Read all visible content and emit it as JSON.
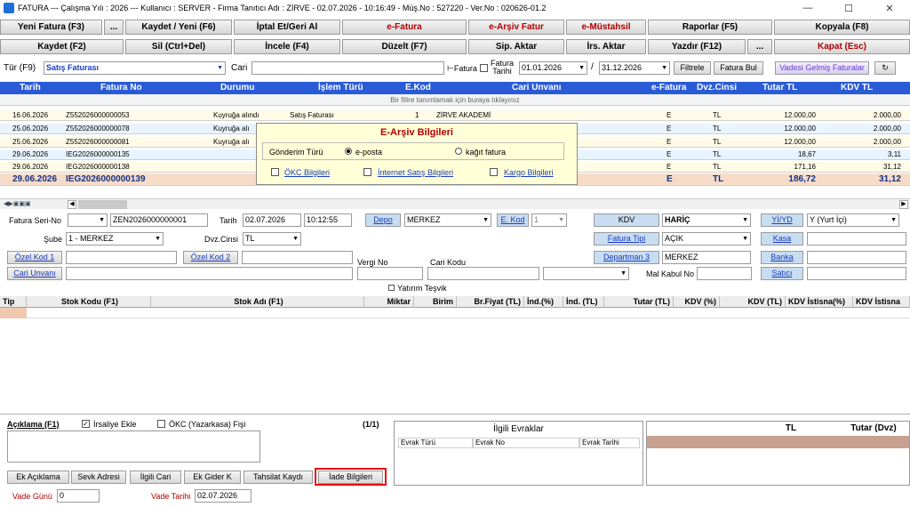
{
  "titlebar": {
    "text": "FATURA  ---  Çalışma Yılı : 2026  ---  Kullanıcı : SERVER - Firma Tanıtıcı Adı : ZİRVE - 02.07.2026 - 10:16:49 - Müş.No : 527220 - Ver.No : 020626-01.2",
    "minimize": "—",
    "maximize": "☐",
    "close": "✕"
  },
  "toolbar1": {
    "new_invoice": "Yeni Fatura (F3)",
    "dots1": "...",
    "save_new": "Kaydet / Yeni (F6)",
    "cancel_restore": "İptal Et/Geri Al",
    "e_invoice": "e-Fatura",
    "e_archive": "e-Arşiv Fatur",
    "e_producer": "e-Müstahsil",
    "reports": "Raporlar (F5)",
    "copy": "Kopyala (F8)"
  },
  "toolbar2": {
    "save": "Kaydet (F2)",
    "delete": "Sil (Ctrl+Del)",
    "review": "İncele (F4)",
    "edit": "Düzelt (F7)",
    "order_transfer": "Sip. Aktar",
    "waybill_transfer": "İrs. Aktar",
    "print": "Yazdır (F12)",
    "dots2": "...",
    "close": "Kapat (Esc)"
  },
  "filter": {
    "type_label": "Tür (F9)",
    "type_value": "Satış Faturası",
    "cari_label": "Cari",
    "e_invoice_label": "⊢Fatura",
    "invoice_date_label1": "Fatura",
    "invoice_date_label2": "Tarihi",
    "date_from": "01.01.2026",
    "date_sep": "/",
    "date_to": "31.12.2026",
    "filter_btn": "Filtrele",
    "invoice_find": "Fatura Bul",
    "due_invoices": "Vadesi Gelmiş Faturalar",
    "refresh": "↻"
  },
  "grid": {
    "columns": [
      "Tarih",
      "Fatura No",
      "Durumu",
      "İşlem Türü",
      "E.Kod",
      "Cari Unvanı",
      "e-Fatura",
      "Dvz.Cinsi",
      "Tutar TL",
      "KDV TL"
    ],
    "filter_hint": "Bir filtre tanımlamak için buraya tıklayınız",
    "rows": [
      {
        "date": "16.06.2026",
        "no": "Z552026000000053",
        "status": "Kuyruğa alındı",
        "type": "Satış Faturası",
        "ekod": "1",
        "cari": "ZİRVE AKADEMİ",
        "ef": "E",
        "cur": "TL",
        "total": "12.000,00",
        "kdv": "2.000,00"
      },
      {
        "date": "25.06.2026",
        "no": "Z552026000000078",
        "status": "Kuyruğa alı",
        "type": "",
        "ekod": "",
        "cari": "",
        "ef": "E",
        "cur": "TL",
        "total": "12.000,00",
        "kdv": "2.000,00"
      },
      {
        "date": "25.06.2026",
        "no": "Z552026000000081",
        "status": "Kuyruğa alı",
        "type": "",
        "ekod": "",
        "cari": "",
        "ef": "E",
        "cur": "TL",
        "total": "12.000,00",
        "kdv": "2.000,00"
      },
      {
        "date": "29.06.2026",
        "no": "IEG2026000000135",
        "status": "",
        "type": "",
        "ekod": "",
        "cari": "",
        "ef": "E",
        "cur": "TL",
        "total": "18,67",
        "kdv": "3,11"
      },
      {
        "date": "29.06.2026",
        "no": "IEG2026000000138",
        "status": "",
        "type": "",
        "ekod": "",
        "cari": "",
        "ef": "E",
        "cur": "TL",
        "total": "171,16",
        "kdv": "31,12"
      },
      {
        "date": "29.06.2026",
        "no": "IEG2026000000139",
        "status": "",
        "type": "",
        "ekod": "",
        "cari": "",
        "ef": "E",
        "cur": "TL",
        "total": "186,72",
        "kdv": "31,12"
      }
    ]
  },
  "popup": {
    "title": "E-Arşiv Bilgileri",
    "send_type_label": "Gönderim Türü",
    "opt_email": "e-posta",
    "opt_paper": "kağıt fatura",
    "okc": "ÖKC Bilgileri",
    "internet": "İnternet Satış Bilgileri",
    "cargo": "Kargo Bilgileri"
  },
  "form": {
    "series_label": "Fatura Seri-No",
    "series_value": "ZEN2026000000001",
    "date_label": "Tarih",
    "date_value": "02.07.2026",
    "time_value": "10:12:55",
    "depo_btn": "Depo",
    "depo_value": "MERKEZ",
    "ekod_btn": "E. Kod",
    "ekod_value": "1",
    "kdv_btn": "KDV",
    "kdv_value": "HARİÇ",
    "yiyd_btn": "Yİ/YD",
    "yiyd_value": "Y (Yurt İçi)",
    "branch_label": "Şube",
    "branch_value": "1 - MERKEZ",
    "currency_label": "Dvz.Cinsi",
    "currency_value": "TL",
    "invoice_type_btn": "Fatura Tipi",
    "invoice_type_value": "AÇIK",
    "cash_btn": "Kasa",
    "special1_btn": "Özel Kod 1",
    "special2_btn": "Özel Kod 2",
    "department_btn": "Departman 3",
    "department_value": "MERKEZ",
    "bank_btn": "Banka",
    "tax_no_label": "Vergi No",
    "cari_code_label": "Cari Kodu",
    "acceptance_label": "Mal Kabul No",
    "seller_btn": "Satıcı",
    "cari_title_btn": "Cari Unvanı",
    "investment_label": "Yatırım Teşvik"
  },
  "detail_grid": {
    "columns": [
      "Tip",
      "Stok Kodu (F1)",
      "Stok Adı (F1)",
      "Miktar",
      "Birim",
      "Br.Fiyat (TL)",
      "İnd.(%)",
      "İnd. (TL)",
      "Tutar (TL)",
      "KDV (%)",
      "KDV (TL)",
      "KDV İstisna(%)",
      "KDV İstisna"
    ]
  },
  "bottom": {
    "description_label": "Açıklama (F1)",
    "waybill_add": "İrsaliye Ekle",
    "okc_receipt": "ÖKC (Yazarkasa) Fişi",
    "page_counter": "(1/1)",
    "docs_title": "İlgili Evraklar",
    "doc_cols": [
      "Evrak Türü",
      "Evrak No",
      "Evrak Tarihi"
    ],
    "total_cols": [
      "TL",
      "Tutar (Dvz)"
    ],
    "btn_extra_desc": "Ek Açıklama",
    "btn_ship_addr": "Sevk Adresi",
    "btn_related_cari": "İlgili Cari",
    "btn_extra_cost": "Ek Gider K",
    "btn_collection": "Tahsilat Kaydı",
    "btn_return": "İade Bilgileri",
    "due_days_label": "Vade Günü",
    "due_days_value": "0",
    "due_date_label": "Vade Tarihi",
    "due_date_value": "02.07.2026"
  },
  "colors": {
    "header_blue": "#2a5bd7",
    "red_text": "#b00000",
    "highlight_box": "#e01010",
    "selected_row": "#f6dcc8"
  }
}
